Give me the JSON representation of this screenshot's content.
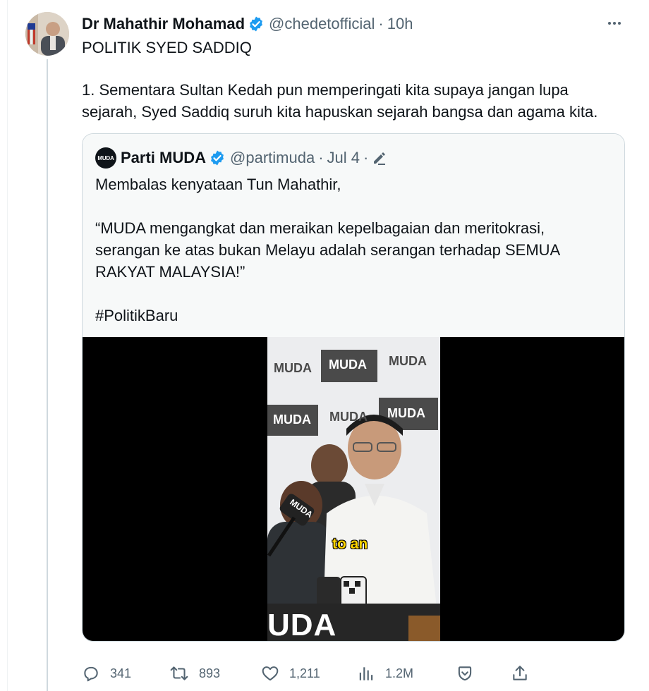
{
  "tweet": {
    "display_name": "Dr Mahathir Mohamad",
    "handle": "@chedetofficial",
    "separator": "·",
    "time": "10h",
    "text_lines": [
      "POLITIK SYED SADDIQ",
      "1. Sementara Sultan Kedah pun memperingati kita supaya jangan lupa sejarah, Syed Saddiq suruh kita hapuskan sejarah bangsa dan agama kita."
    ]
  },
  "quote": {
    "avatar_text": "MUDA",
    "display_name": "Parti MUDA",
    "handle": "@partimuda",
    "separator": "·",
    "date": "Jul 4",
    "separator2": "·",
    "lines": [
      "Membalas kenyataan Tun Mahathir,",
      "“MUDA mengangkat dan meraikan kepelbagaian dan meritokrasi, serangan ke atas bukan Melayu adalah serangan terhadap SEMUA RAKYAT MALAYSIA!”",
      "#PolitikBaru"
    ],
    "video": {
      "backdrop_text": "MUDA",
      "podium_text": "UDA",
      "mic_text": "MUDA",
      "caption": "to an"
    }
  },
  "actions": {
    "replies": "341",
    "reposts": "893",
    "likes": "1,211",
    "views": "1.2M"
  },
  "colors": {
    "verified": "#1d9bf0",
    "muted": "#536471",
    "border": "#cfd9de",
    "caption": "#ffd400"
  },
  "icons": [
    "verified-badge-icon",
    "more-icon",
    "edit-icon",
    "reply-icon",
    "repost-icon",
    "like-icon",
    "views-icon",
    "bookmark-icon",
    "share-icon"
  ]
}
